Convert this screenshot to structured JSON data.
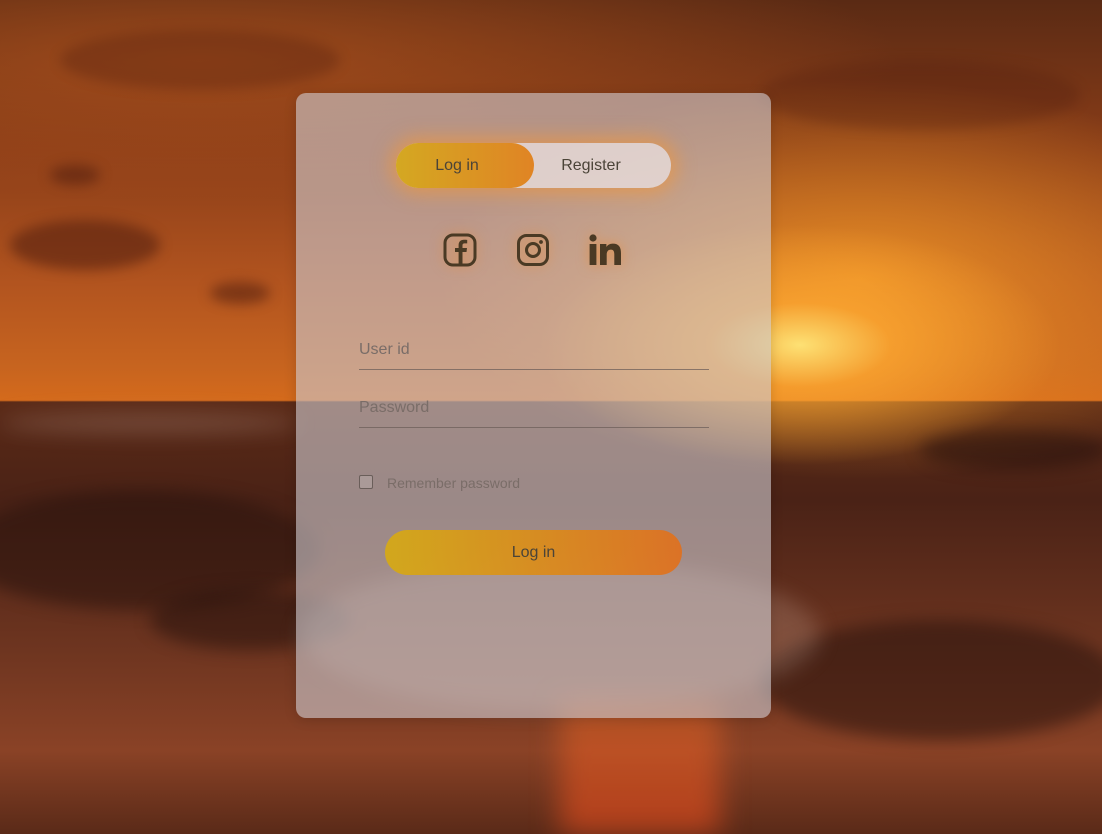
{
  "auth_tabs": {
    "login_label": "Log in",
    "register_label": "Register",
    "active": "login"
  },
  "social": {
    "facebook_icon": "facebook-icon",
    "instagram_icon": "instagram-icon",
    "linkedin_icon": "linkedin-icon"
  },
  "form": {
    "userid_placeholder": "User id",
    "password_placeholder": "Password",
    "remember_label": "Remember password",
    "remember_checked": false,
    "submit_label": "Log in"
  },
  "colors": {
    "accent_start": "#d4a822",
    "accent_end": "#e08424",
    "text": "#4b4438",
    "muted_text": "#7a6d68"
  }
}
